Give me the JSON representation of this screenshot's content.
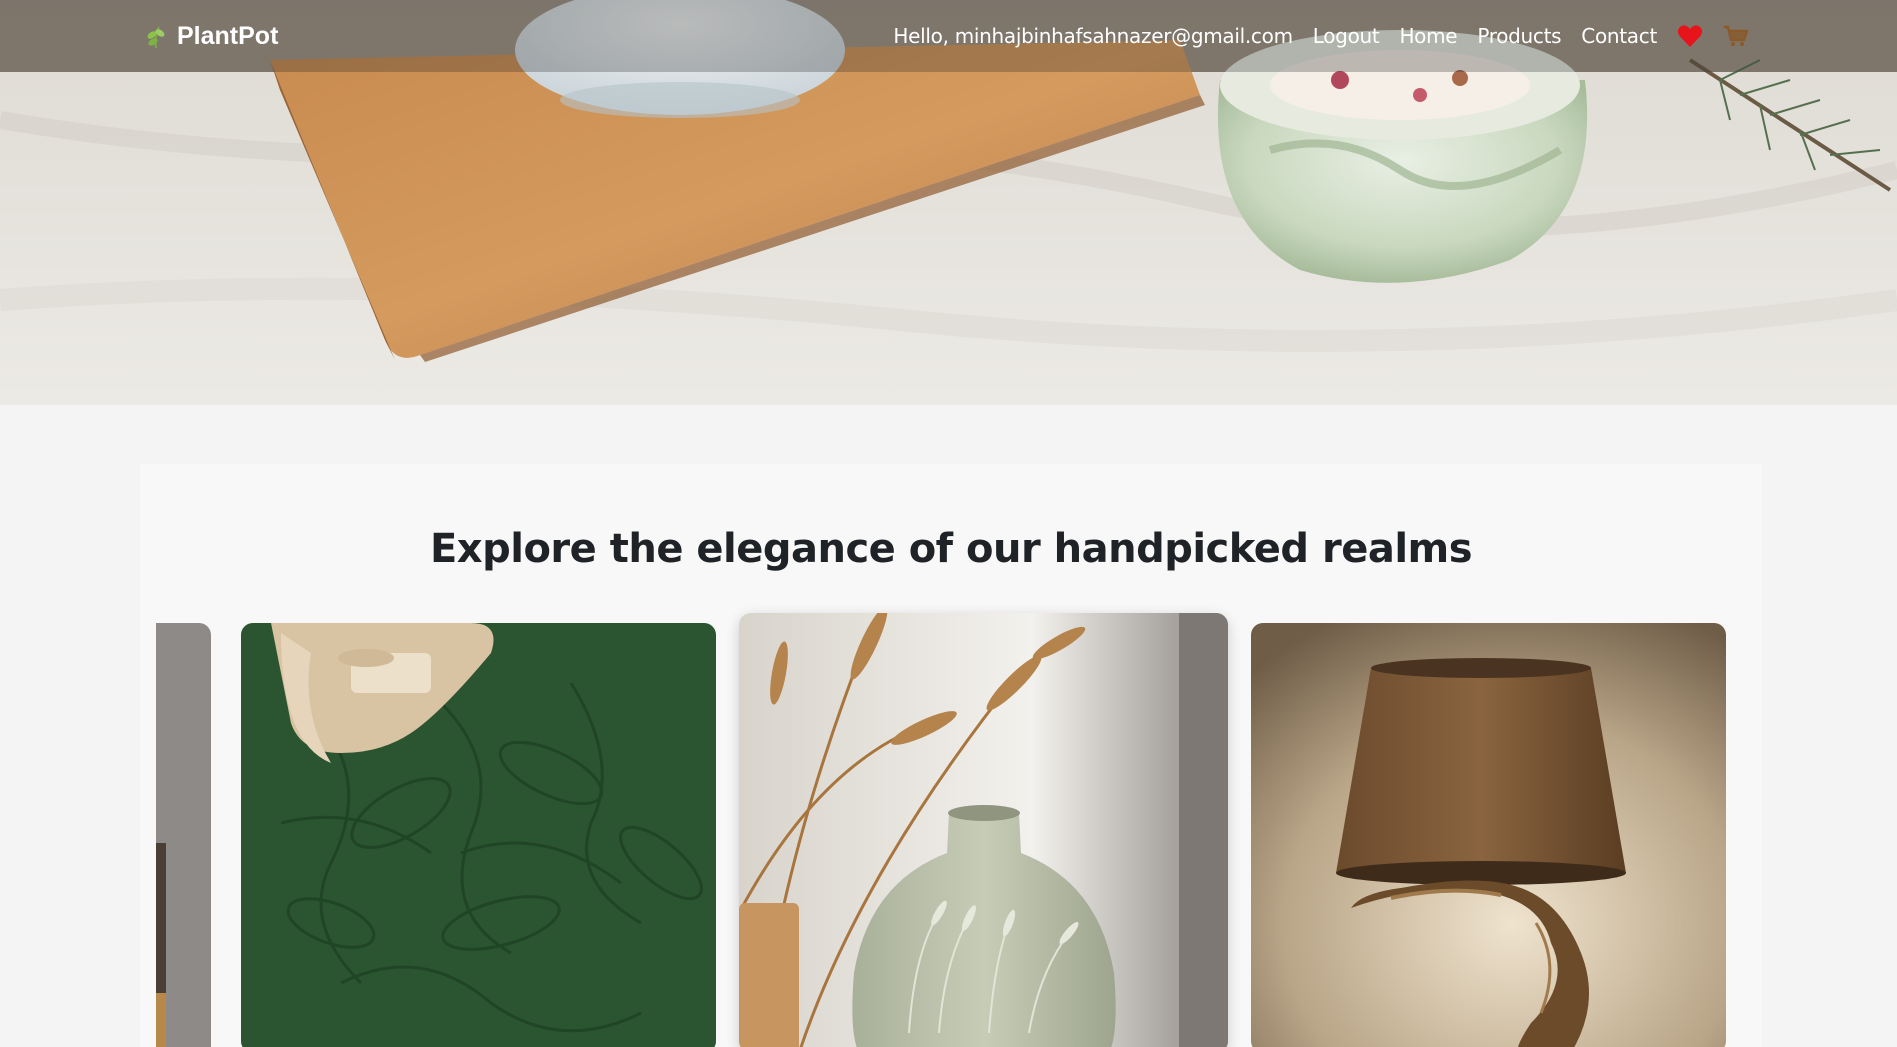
{
  "navbar": {
    "brand": "PlantPot",
    "greeting": "Hello, minhajbinhafsahnazer@gmail.com",
    "links": [
      "Logout",
      "Home",
      "Products",
      "Contact"
    ]
  },
  "icons": {
    "brand": "leaf-icon",
    "wishlist": "heart-icon",
    "cart": "cart-icon"
  },
  "colors": {
    "heart": "#e8141c",
    "cart": "#8a5a2b",
    "leaf": "#8bc34a"
  },
  "section": {
    "title": "Explore the elegance of our handpicked realms"
  },
  "cards": [
    {
      "name": "partial-product-card"
    },
    {
      "name": "green-rug-card"
    },
    {
      "name": "ceramic-vase-card"
    },
    {
      "name": "driftwood-lamp-card"
    }
  ]
}
